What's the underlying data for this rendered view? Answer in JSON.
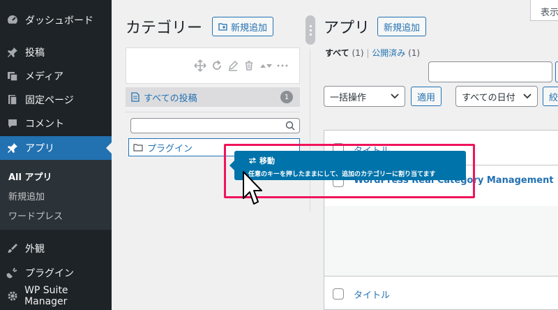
{
  "sidebar": {
    "items": [
      {
        "label": "ダッシュボード",
        "icon": "dashboard-icon"
      },
      {
        "label": "投稿",
        "icon": "pin-icon"
      },
      {
        "label": "メディア",
        "icon": "media-icon"
      },
      {
        "label": "固定ページ",
        "icon": "pages-icon"
      },
      {
        "label": "コメント",
        "icon": "comment-icon"
      },
      {
        "label": "アプリ",
        "icon": "pin-icon"
      },
      {
        "label": "外観",
        "icon": "brush-icon"
      },
      {
        "label": "プラグイン",
        "icon": "plugin-icon"
      },
      {
        "label": "WP Suite Manager",
        "icon": "gear-icon"
      }
    ],
    "submenu": [
      "All アプリ",
      "新規追加",
      "ワードプレス"
    ]
  },
  "category_panel": {
    "title": "カテゴリー",
    "add_new": "新規追加",
    "all_posts": "すべての投稿",
    "all_posts_count": "1",
    "search_placeholder": "",
    "node_label": "プラグイン"
  },
  "main": {
    "title": "アプリ",
    "add_new": "新規追加",
    "screen_options": "表示",
    "filter_all": "すべて",
    "filter_all_count": "(1)",
    "filter_published": "公開済み",
    "filter_published_count": "(1)",
    "bulk_action": "一括操作",
    "apply": "適用",
    "all_dates": "すべての日付",
    "filter_cut": "絞",
    "column_title": "タイトル",
    "row_title": "WordPress Real Category Management",
    "footer_title": "タイトル"
  },
  "tooltip": {
    "title": "移動",
    "body": "任意のキーを押したままにして、追加のカテゴリーに割り当てます"
  },
  "colors": {
    "sidebar_bg": "#1d2327",
    "accent": "#2271b1",
    "tooltip_bg": "#0073aa",
    "highlight": "#f0145a"
  }
}
